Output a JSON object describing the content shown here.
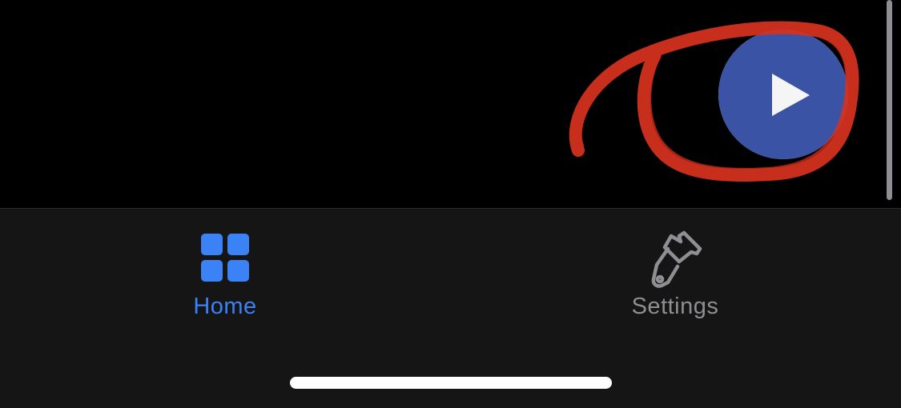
{
  "colors": {
    "background": "#000000",
    "tab_bar_background": "#151515",
    "accent_active": "#3b82f6",
    "inactive": "#8e8e93",
    "play_button_fill": "#3a53a4",
    "play_icon": "#f5f5f5",
    "annotation_stroke": "#d8321e",
    "home_indicator": "#ffffff"
  },
  "main": {
    "play_button": {
      "icon": "play-icon"
    },
    "annotation": {
      "shape": "hand-drawn circle around play button"
    }
  },
  "tab_bar": {
    "tabs": [
      {
        "label": "Home",
        "icon": "grid-icon",
        "active": true
      },
      {
        "label": "Settings",
        "icon": "paintbrush-icon",
        "active": false
      }
    ]
  }
}
